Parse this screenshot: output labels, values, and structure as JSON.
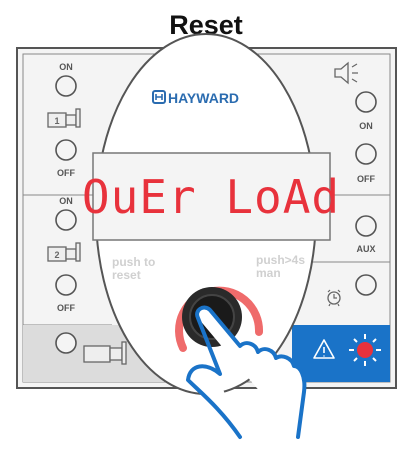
{
  "title": "Reset",
  "brand": "HAYWARD",
  "display": {
    "text": "OuEr LoAd",
    "color": "#e8323c"
  },
  "left_panel": {
    "group1": {
      "on_label": "ON",
      "off_label": "OFF",
      "pump_number": "1"
    },
    "group2": {
      "on_label": "ON",
      "off_label": "OFF",
      "pump_number": "2"
    }
  },
  "right_panel": {
    "speaker_on_label": "ON",
    "speaker_off_label": "OFF",
    "aux_label": "AUX"
  },
  "hints": {
    "push_reset": [
      "push to",
      "reset"
    ],
    "push_man": [
      "push>4s",
      "man"
    ]
  },
  "alert_bar": {
    "color": "#1a73c8",
    "indicator_color": "#e8323c"
  },
  "knob_ring_color": "#ef6b6b",
  "icons": [
    "speaker-icon",
    "pump-icon",
    "alarm-clock-icon",
    "warning-icon",
    "sun-indicator-icon",
    "hand-pointer-icon"
  ]
}
